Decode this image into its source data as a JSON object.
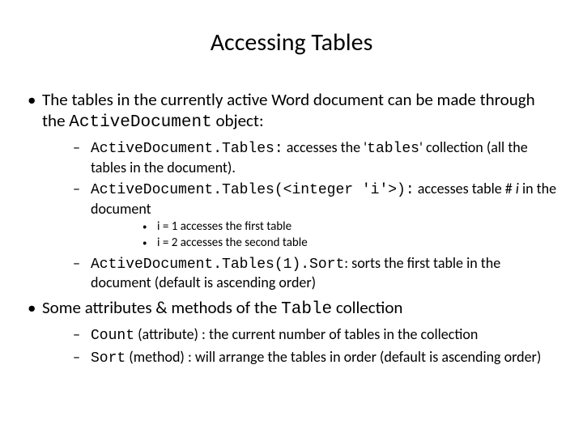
{
  "title": "Accessing Tables",
  "p1a": "The tables in the currently active Word document can be made through the ",
  "p1code": "ActiveDocument",
  "p1b": " object:",
  "s1code": "ActiveDocument.Tables:",
  "s1a": " accesses the '",
  "s1tcode": "tables",
  "s1b": "' collection (all the tables in the document).",
  "s2code": "ActiveDocument.Tables(<integer 'i'>):",
  "s2a": " accesses table # ",
  "s2i": "i",
  "s2b": " in the document",
  "ss1": "i = 1 accesses the first table",
  "ss2": "i = 2 accesses the second table",
  "s3code": "ActiveDocument.Tables(1).Sort",
  "s3a": ": sorts the first table in the document (default is ascending order)",
  "p2a": "Some attributes & methods of the ",
  "p2code": "Table",
  "p2b": " collection",
  "s4code": "Count",
  "s4a": " (attribute) : the current number of tables in the collection",
  "s5code": "Sort",
  "s5a": "  (method) : will arrange the tables in order (default is ascending order)"
}
